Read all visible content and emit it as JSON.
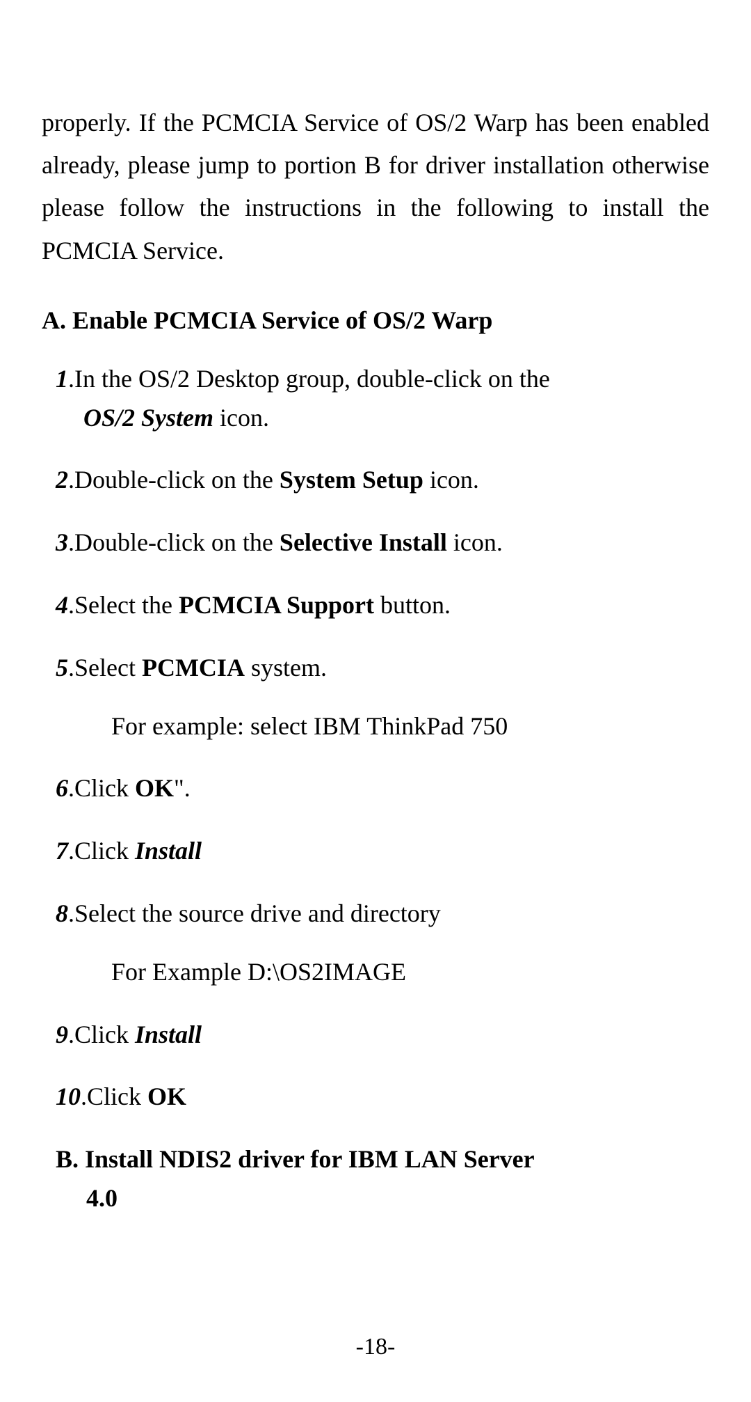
{
  "intro": "properly. If the PCMCIA Service of OS/2 Warp has been enabled already, please jump to portion B for driver installation otherwise please follow the instructions in the following to install the PCMCIA Service.",
  "sectionA": {
    "heading": "A. Enable PCMCIA Service of OS/2 Warp",
    "steps": {
      "s1": {
        "num": "1",
        "pre": ".In the OS/2 Desktop group, double-click on the ",
        "bold": "OS/2 System",
        "post": " icon."
      },
      "s2": {
        "num": "2",
        "pre": ".Double-click on the ",
        "bold": "System Setup",
        "post": " icon."
      },
      "s3": {
        "num": "3",
        "pre": ".Double-click on the ",
        "bold": "Selective Install",
        "post": " icon."
      },
      "s4": {
        "num": "4",
        "pre": ".Select the ",
        "bold": "PCMCIA Support",
        "post": " button."
      },
      "s5": {
        "num": "5",
        "pre": ".Select ",
        "bold": "PCMCIA",
        "post": " system.",
        "example": "For example: select IBM ThinkPad 750"
      },
      "s6": {
        "num": "6",
        "pre": ".Click ",
        "bold": "OK",
        "post": "\"."
      },
      "s7": {
        "num": "7",
        "pre": ".Click ",
        "boldit": "Install",
        "post": ""
      },
      "s8": {
        "num": "8",
        "text": ".Select the source drive and directory",
        "example": "For Example D:\\OS2IMAGE"
      },
      "s9": {
        "num": "9",
        "pre": ".Click ",
        "boldit": "Install",
        "post": ""
      },
      "s10": {
        "num": "10",
        "pre": ".Click ",
        "bold": "OK",
        "post": ""
      }
    }
  },
  "sectionB": {
    "headingLine1": "B.  Install  NDIS2  driver  for  IBM  LAN  Server",
    "headingLine2": "4.0"
  },
  "pageNumber": "-18-"
}
